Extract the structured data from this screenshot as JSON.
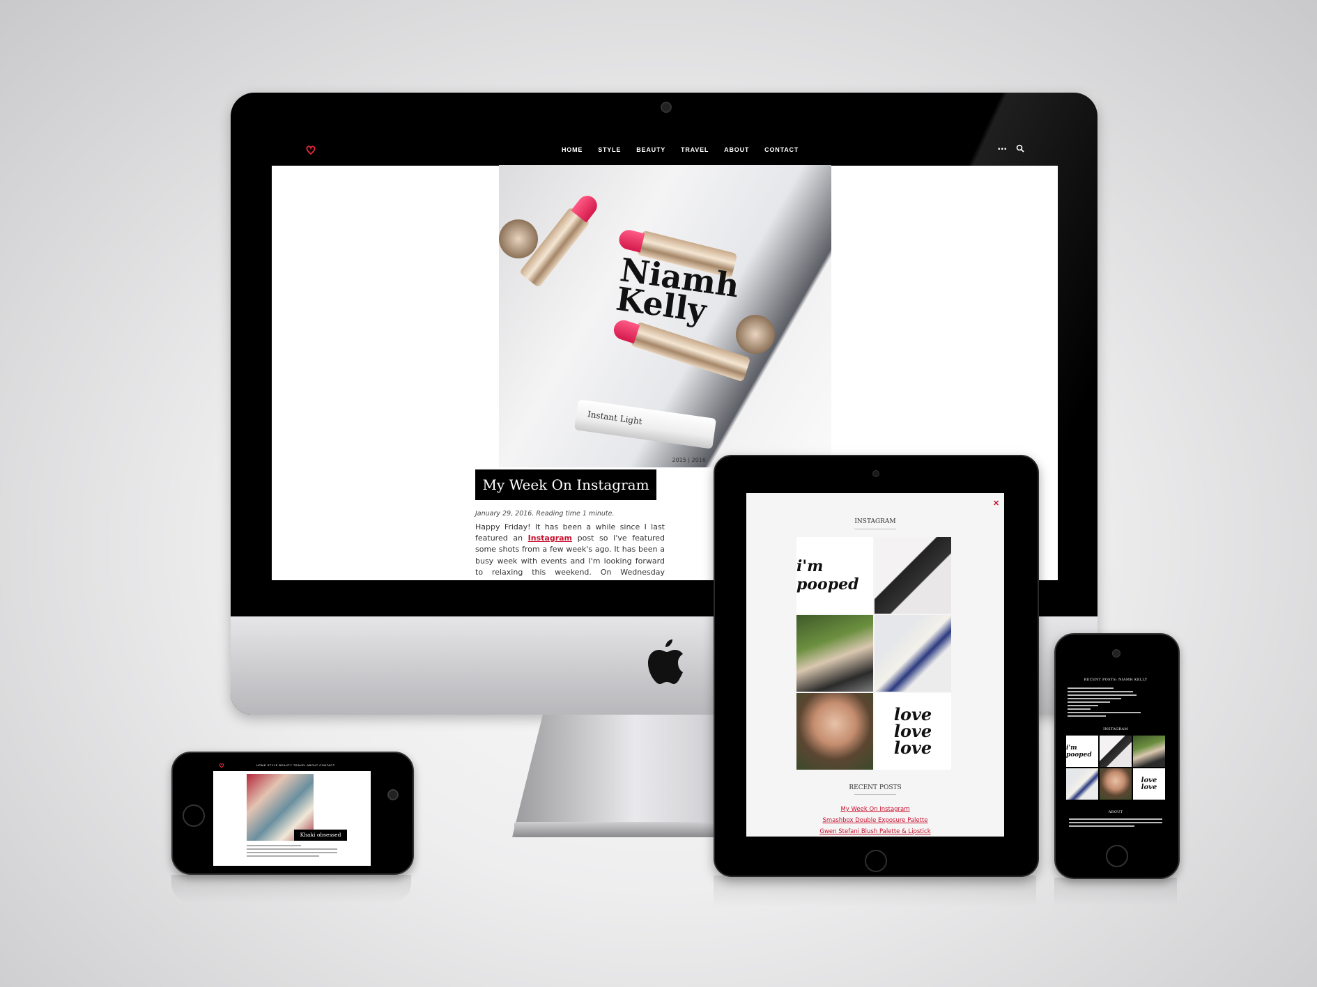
{
  "desktop": {
    "nav": {
      "items": [
        "HOME",
        "STYLE",
        "BEAUTY",
        "TRAVEL",
        "ABOUT",
        "CONTACT"
      ],
      "more_icon": "ellipsis-icon",
      "search_icon": "search-icon",
      "logo_icon": "heart-logo-icon"
    },
    "hero": {
      "handwriting": "Niamh Kelly",
      "product_label": "Instant Light",
      "caption": "2015 | 2016"
    },
    "post": {
      "title": "My Week On Instagram",
      "meta": "January 29, 2016.  Reading time 1 minute.",
      "body_part1": "Happy Friday! It has been a while since I last featured an ",
      "body_link": "Instagram",
      "body_part2": " post so I've featured some shots from a few week's ago. It has been a busy week with events and I'm looking forward to relaxing this weekend. On Wednesday evening I attended an intimate skincare gathering in the"
    }
  },
  "tablet": {
    "close_icon": "close-icon",
    "instagram_title": "INSTAGRAM",
    "tiles": [
      {
        "text": "i'm pooped"
      },
      {
        "text": ""
      },
      {
        "text": ""
      },
      {
        "text": ""
      },
      {
        "text": ""
      },
      {
        "text": "love love love"
      }
    ],
    "recent_title": "RECENT POSTS",
    "recent_posts": [
      "My Week On Instagram",
      "Smashbox Double Exposure Palette",
      "Gwen Stefani Blush Palette & Lipstick"
    ]
  },
  "phone_landscape": {
    "nav_text": "HOME  STYLE  BEAUTY  TRAVEL  ABOUT  CONTACT",
    "post_title": "Khaki obsessed"
  },
  "phone_portrait": {
    "recent_title": "RECENT POSTS: NIAMH KELLY",
    "instagram_title": "INSTAGRAM",
    "about_title": "ABOUT",
    "tiles": [
      {
        "text": "i'm pooped"
      },
      {
        "text": ""
      },
      {
        "text": ""
      },
      {
        "text": ""
      },
      {
        "text": ""
      },
      {
        "text": "love love"
      }
    ]
  },
  "colors": {
    "accent": "#c8102e",
    "nav_bg": "#000000",
    "page_bg": "#ffffff"
  }
}
